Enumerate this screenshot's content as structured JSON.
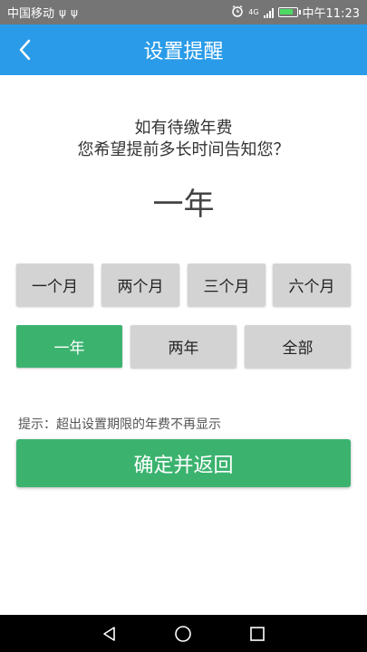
{
  "status_bar": {
    "carrier": "中国移动",
    "usb_icons": [
      "ψ",
      "ψ"
    ],
    "network": "4G",
    "time": "中午11:23",
    "battery_level": 0.85,
    "battery_color": "#4cd964"
  },
  "app_bar": {
    "title": "设置提醒",
    "color": "#2a9be8"
  },
  "prompt": {
    "line1": "如有待缴年费",
    "line2": "您希望提前多长时间告知您？"
  },
  "selected_value": "一年",
  "options_row1": [
    "一个月",
    "两个月",
    "三个月",
    "六个月"
  ],
  "options_row2": [
    "一年",
    "两年",
    "全部"
  ],
  "active_option": "一年",
  "accent_color": "#3bb36f",
  "hint": "提示：超出设置期限的年费不再显示",
  "confirm_label": "确定并返回",
  "nav_bar": {
    "icons": [
      "back-triangle",
      "home-circle",
      "recents-square"
    ]
  }
}
